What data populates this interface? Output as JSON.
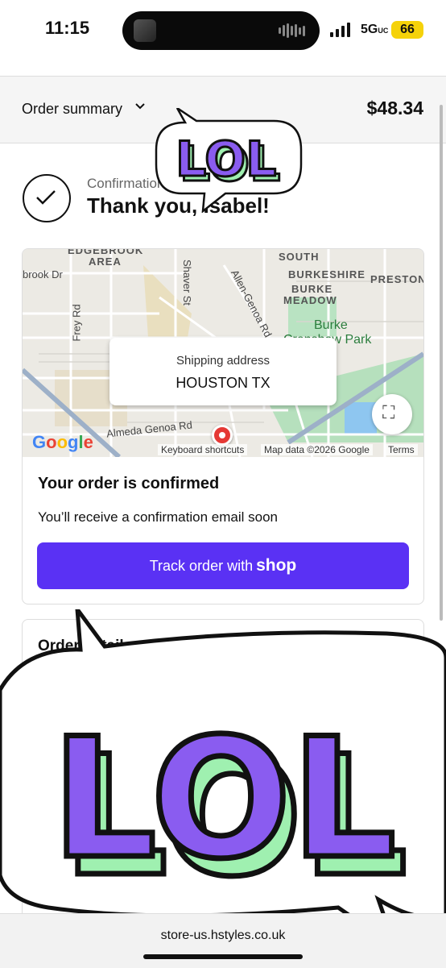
{
  "status_bar": {
    "time": "11:15",
    "network": "5G",
    "network_suffix": "UC",
    "battery": "66"
  },
  "summary": {
    "label": "Order summary",
    "total": "$48.34"
  },
  "confirmation": {
    "number_label": "Confirmation",
    "thanks": "Thank you, Isabel!"
  },
  "map": {
    "labels": {
      "edgebrook": "EDGEBROOK",
      "area": "AREA",
      "south": "SOUTH",
      "burkeshire": "BURKESHIRE",
      "preston": "PRESTON",
      "burke": "BURKE",
      "meadow": "MEADOW",
      "burke_park_1": "Burke",
      "burke_park_2": "Crenshaw Park",
      "brook_dr": "brook Dr",
      "frey_rd": "Frey Rd",
      "shaver_st": "Shaver St",
      "allen_genoa_rd": "Allen-Genoa Rd",
      "almeda_genoa_rd": "Almeda Genoa Rd"
    },
    "google": "Google",
    "keyboard_shortcuts": "Keyboard shortcuts",
    "map_data": "Map data ©2026 Google",
    "terms": "Terms",
    "shipping_label": "Shipping address",
    "shipping_value": "HOUSTON TX"
  },
  "order": {
    "title": "Your order is confirmed",
    "subtitle": "You’ll receive a confirmation email soon",
    "track_label": "Track order with",
    "track_brand": "shop"
  },
  "details": {
    "title": "Order details"
  },
  "stickers": {
    "small_text": "LOL",
    "large_text": "LOL"
  },
  "browser": {
    "url": "store-us.hstyles.co.uk"
  },
  "colors": {
    "accent": "#5a31f4",
    "sticker_purple": "#8a5cf0",
    "sticker_green": "#9ff0b0"
  }
}
